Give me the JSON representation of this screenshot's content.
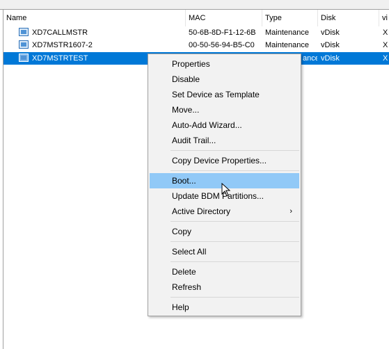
{
  "columns": {
    "name": "Name",
    "mac": "MAC",
    "type": "Type",
    "disk": "Disk",
    "extra": "vi"
  },
  "rows": [
    {
      "name": "XD7CALLMSTR",
      "mac": "50-6B-8D-F1-12-6B",
      "type": "Maintenance",
      "disk": "vDisk",
      "extra": "X"
    },
    {
      "name": "XD7MSTR1607-2",
      "mac": "00-50-56-94-B5-C0",
      "type": "Maintenance",
      "disk": "vDisk",
      "extra": "X"
    },
    {
      "name": "XD7MSTRTEST",
      "mac": "",
      "type": "ance",
      "disk": "vDisk",
      "extra": "X",
      "selected": true
    }
  ],
  "context_menu": {
    "items": [
      {
        "label": "Properties"
      },
      {
        "label": "Disable"
      },
      {
        "label": "Set Device as Template"
      },
      {
        "label": "Move..."
      },
      {
        "label": "Auto-Add Wizard..."
      },
      {
        "label": "Audit Trail..."
      },
      {
        "label": "Copy Device Properties..."
      },
      {
        "label": "Boot...",
        "highlighted": true
      },
      {
        "label": "Update BDM Partitions..."
      },
      {
        "label": "Active Directory",
        "submenu_arrow": "›"
      },
      {
        "label": "Copy"
      },
      {
        "label": "Select All"
      },
      {
        "label": "Delete"
      },
      {
        "label": "Refresh"
      },
      {
        "label": "Help"
      }
    ]
  },
  "icons": {
    "device": "device-icon",
    "cursor": "mouse-pointer-icon"
  },
  "colors": {
    "selection": "#0078d7",
    "menu_hover": "#91c9f7",
    "menu_bg": "#f2f2f2"
  }
}
